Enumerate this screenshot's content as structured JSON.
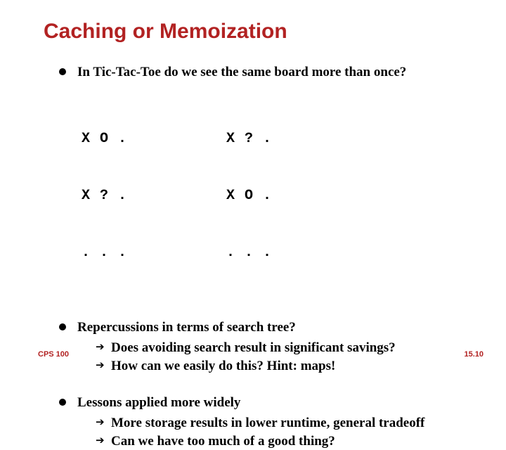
{
  "title": "Caching or Memoization",
  "bullets": {
    "b1": {
      "text": "In Tic-Tac-Toe do we see the same board more than once?"
    },
    "b2": {
      "text": "Repercussions in terms of search tree?",
      "sub": [
        "Does avoiding search result in significant savings?",
        "How can we easily do this? Hint: maps!"
      ]
    },
    "b3": {
      "text": "Lessons applied more widely",
      "sub": [
        "More storage results in lower runtime, general tradeoff",
        "Can we have too much of a good thing?"
      ]
    }
  },
  "boards": {
    "left": [
      [
        "X",
        "O",
        "."
      ],
      [
        "X",
        "?",
        "."
      ],
      [
        ".",
        ".",
        "."
      ]
    ],
    "right": [
      [
        "X",
        "?",
        "."
      ],
      [
        "X",
        "O",
        "."
      ],
      [
        ".",
        ".",
        "."
      ]
    ]
  },
  "footer": {
    "course": "CPS 100",
    "page": "15.10"
  }
}
